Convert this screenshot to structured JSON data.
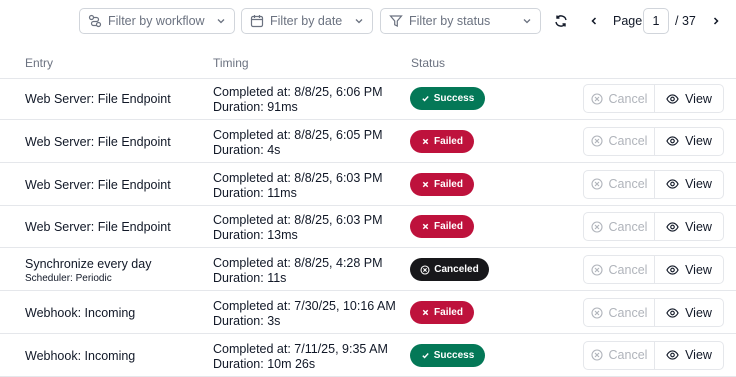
{
  "toolbar": {
    "filter_workflow_placeholder": "Filter by workflow",
    "filter_date_placeholder": "Filter by date",
    "filter_status_placeholder": "Filter by status",
    "page_label": "Page",
    "page_current": "1",
    "page_total": "/ 37"
  },
  "table": {
    "headers": {
      "entry": "Entry",
      "timing": "Timing",
      "status": "Status"
    },
    "cancel_label": "Cancel",
    "view_label": "View",
    "rows": [
      {
        "entry": "Web Server: File Endpoint",
        "sub": "",
        "completed": "Completed at: 8/8/25, 6:06 PM",
        "duration": "Duration: 91ms",
        "status": "Success",
        "status_kind": "success"
      },
      {
        "entry": "Web Server: File Endpoint",
        "sub": "",
        "completed": "Completed at: 8/8/25, 6:05 PM",
        "duration": "Duration: 4s",
        "status": "Failed",
        "status_kind": "failed"
      },
      {
        "entry": "Web Server: File Endpoint",
        "sub": "",
        "completed": "Completed at: 8/8/25, 6:03 PM",
        "duration": "Duration: 11ms",
        "status": "Failed",
        "status_kind": "failed"
      },
      {
        "entry": "Web Server: File Endpoint",
        "sub": "",
        "completed": "Completed at: 8/8/25, 6:03 PM",
        "duration": "Duration: 13ms",
        "status": "Failed",
        "status_kind": "failed"
      },
      {
        "entry": "Synchronize every day",
        "sub": "Scheduler: Periodic",
        "completed": "Completed at: 8/8/25, 4:28 PM",
        "duration": "Duration: 11s",
        "status": "Canceled",
        "status_kind": "canceled"
      },
      {
        "entry": "Webhook: Incoming",
        "sub": "",
        "completed": "Completed at: 7/30/25, 10:16 AM",
        "duration": "Duration: 3s",
        "status": "Failed",
        "status_kind": "failed"
      },
      {
        "entry": "Webhook: Incoming",
        "sub": "",
        "completed": "Completed at: 7/11/25, 9:35 AM",
        "duration": "Duration: 10m 26s",
        "status": "Success",
        "status_kind": "success"
      }
    ]
  },
  "colors": {
    "success": "#047857",
    "failed": "#be123c",
    "canceled": "#18181b"
  },
  "icons": {
    "workflow_filter": "workflow-icon",
    "date_filter": "calendar-icon",
    "status_filter": "funnel-icon",
    "refresh": "refresh-icon",
    "prev": "chevron-left-icon",
    "next": "chevron-right-icon",
    "cancel": "cancel-circle-icon",
    "view": "eye-icon"
  }
}
